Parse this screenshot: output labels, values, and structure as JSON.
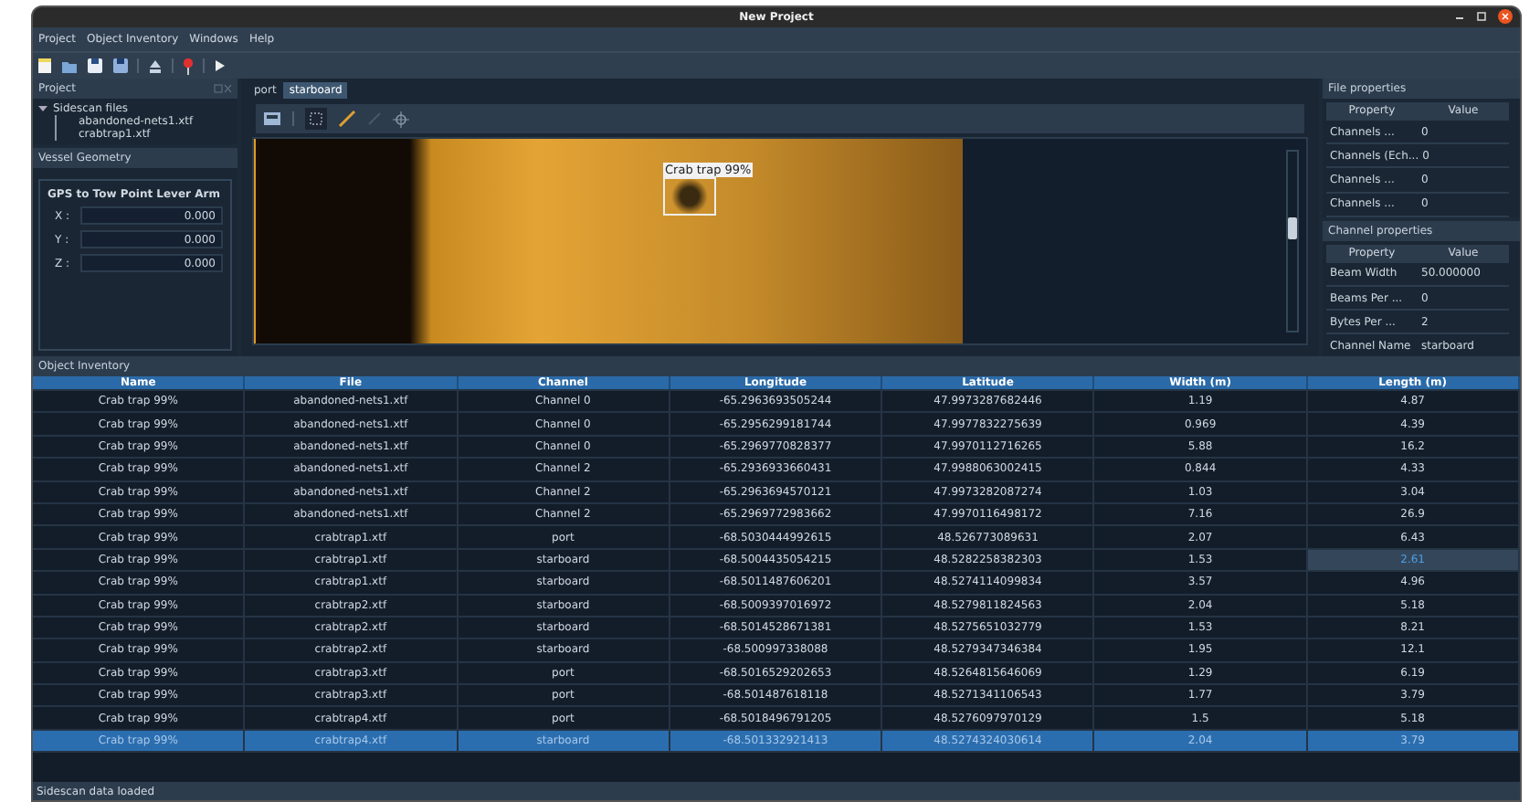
{
  "window": {
    "title": "New Project"
  },
  "menu": [
    "Project",
    "Object Inventory",
    "Windows",
    "Help"
  ],
  "project_dock": {
    "title": "Project",
    "tree": [
      {
        "label": "Sidescan files",
        "expanded": true,
        "children": [
          {
            "label": "abandoned-nets1.xtf"
          },
          {
            "label": "crabtrap1.xtf"
          }
        ]
      }
    ]
  },
  "vessel_dock": {
    "title": "Vessel Geometry",
    "group": "GPS to Tow Point Lever Arm",
    "fields": [
      {
        "label": "X :",
        "value": "0.000"
      },
      {
        "label": "Y :",
        "value": "0.000"
      },
      {
        "label": "Z :",
        "value": "0.000"
      }
    ]
  },
  "tabs": [
    {
      "label": "port",
      "selected": false
    },
    {
      "label": "starboard",
      "selected": true
    }
  ],
  "viewer": {
    "detection_label": "Crab trap 99%"
  },
  "file_properties": {
    "title": "File properties",
    "columns": [
      "Property",
      "Value"
    ],
    "rows": [
      [
        "Channels ...",
        "0"
      ],
      [
        "Channels (Ech...",
        "0"
      ],
      [
        "Channels ...",
        "0"
      ],
      [
        "Channels ...",
        "0"
      ]
    ]
  },
  "channel_properties": {
    "title": "Channel properties",
    "columns": [
      "Property",
      "Value"
    ],
    "rows": [
      [
        "Beam Width",
        "50.000000"
      ],
      [
        "Beams Per ...",
        "0"
      ],
      [
        "Bytes Per ...",
        "2"
      ],
      [
        "Channel Name",
        "starboard"
      ]
    ]
  },
  "inventory": {
    "title": "Object Inventory",
    "columns": [
      "Name",
      "File",
      "Channel",
      "Longitude",
      "Latitude",
      "Width (m)",
      "Length (m)"
    ],
    "rows": [
      {
        "cells": [
          "Crab trap 99%",
          "abandoned-nets1.xtf",
          "Channel 0",
          "-65.2963693505244",
          "47.9973287682446",
          "1.19",
          "4.87"
        ],
        "selected": false,
        "length_focused": false
      },
      {
        "cells": [
          "Crab trap 99%",
          "abandoned-nets1.xtf",
          "Channel 0",
          "-65.2956299181744",
          "47.9977832275639",
          "0.969",
          "4.39"
        ],
        "selected": false,
        "length_focused": false
      },
      {
        "cells": [
          "Crab trap 99%",
          "abandoned-nets1.xtf",
          "Channel 0",
          "-65.2969770828377",
          "47.9970112716265",
          "5.88",
          "16.2"
        ],
        "selected": false,
        "length_focused": false
      },
      {
        "cells": [
          "Crab trap 99%",
          "abandoned-nets1.xtf",
          "Channel 2",
          "-65.2936933660431",
          "47.9988063002415",
          "0.844",
          "4.33"
        ],
        "selected": false,
        "length_focused": false
      },
      {
        "cells": [
          "Crab trap 99%",
          "abandoned-nets1.xtf",
          "Channel 2",
          "-65.2963694570121",
          "47.9973282087274",
          "1.03",
          "3.04"
        ],
        "selected": false,
        "length_focused": false
      },
      {
        "cells": [
          "Crab trap 99%",
          "abandoned-nets1.xtf",
          "Channel 2",
          "-65.2969772983662",
          "47.9970116498172",
          "7.16",
          "26.9"
        ],
        "selected": false,
        "length_focused": false
      },
      {
        "cells": [
          "Crab trap 99%",
          "crabtrap1.xtf",
          "port",
          "-68.5030444992615",
          "48.526773089631",
          "2.07",
          "6.43"
        ],
        "selected": false,
        "length_focused": false
      },
      {
        "cells": [
          "Crab trap 99%",
          "crabtrap1.xtf",
          "starboard",
          "-68.5004435054215",
          "48.5282258382303",
          "1.53",
          "2.61"
        ],
        "selected": false,
        "length_focused": true
      },
      {
        "cells": [
          "Crab trap 99%",
          "crabtrap1.xtf",
          "starboard",
          "-68.5011487606201",
          "48.5274114099834",
          "3.57",
          "4.96"
        ],
        "selected": false,
        "length_focused": false
      },
      {
        "cells": [
          "Crab trap 99%",
          "crabtrap2.xtf",
          "starboard",
          "-68.5009397016972",
          "48.5279811824563",
          "2.04",
          "5.18"
        ],
        "selected": false,
        "length_focused": false
      },
      {
        "cells": [
          "Crab trap 99%",
          "crabtrap2.xtf",
          "starboard",
          "-68.5014528671381",
          "48.5275651032779",
          "1.53",
          "8.21"
        ],
        "selected": false,
        "length_focused": false
      },
      {
        "cells": [
          "Crab trap 99%",
          "crabtrap2.xtf",
          "starboard",
          "-68.500997338088",
          "48.5279347346384",
          "1.95",
          "12.1"
        ],
        "selected": false,
        "length_focused": false
      },
      {
        "cells": [
          "Crab trap 99%",
          "crabtrap3.xtf",
          "port",
          "-68.5016529202653",
          "48.5264815646069",
          "1.29",
          "6.19"
        ],
        "selected": false,
        "length_focused": false
      },
      {
        "cells": [
          "Crab trap 99%",
          "crabtrap3.xtf",
          "port",
          "-68.501487618118",
          "48.5271341106543",
          "1.77",
          "3.79"
        ],
        "selected": false,
        "length_focused": false
      },
      {
        "cells": [
          "Crab trap 99%",
          "crabtrap4.xtf",
          "port",
          "-68.5018496791205",
          "48.5276097970129",
          "1.5",
          "5.18"
        ],
        "selected": false,
        "length_focused": false
      },
      {
        "cells": [
          "Crab trap 99%",
          "crabtrap4.xtf",
          "starboard",
          "-68.501332921413",
          "48.5274324030614",
          "2.04",
          "3.79"
        ],
        "selected": true,
        "length_focused": false
      }
    ]
  },
  "status_bar": "Sidescan data loaded"
}
